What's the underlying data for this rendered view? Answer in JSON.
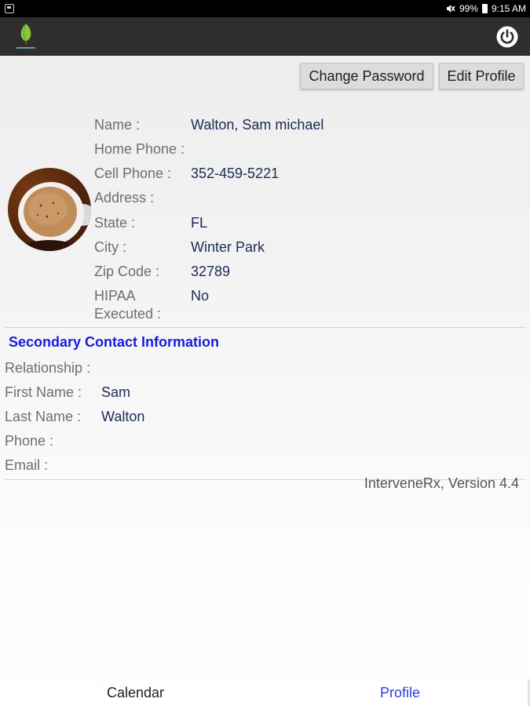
{
  "status_bar": {
    "battery": "99%",
    "time": "9:15 AM"
  },
  "toolbar": {
    "change_password": "Change Password",
    "edit_profile": "Edit Profile"
  },
  "profile": {
    "name_label": "Name :",
    "name_value": "Walton, Sam michael",
    "home_phone_label": "Home Phone :",
    "home_phone_value": "",
    "cell_phone_label": "Cell Phone :",
    "cell_phone_value": "352-459-5221",
    "address_label": "Address :",
    "address_value": "",
    "state_label": "State :",
    "state_value": "FL",
    "city_label": "City :",
    "city_value": "Winter Park",
    "zip_label": "Zip Code :",
    "zip_value": "32789",
    "hipaa_label_line1": "HIPAA",
    "hipaa_label_line2": "Executed :",
    "hipaa_value": "No"
  },
  "secondary": {
    "title": "Secondary Contact Information",
    "relationship_label": "Relationship :",
    "relationship_value": "",
    "first_name_label": "First Name :",
    "first_name_value": "Sam",
    "last_name_label": "Last Name :",
    "last_name_value": "Walton",
    "phone_label": "Phone :",
    "phone_value": "",
    "email_label": "Email :",
    "email_value": ""
  },
  "version": "InterveneRx, Version 4.4",
  "tabs": {
    "calendar": "Calendar",
    "profile": "Profile"
  },
  "colors": {
    "section_title": "#1a1ae0",
    "active_tab": "#2b3fd6",
    "value_text": "#1c2a55"
  }
}
